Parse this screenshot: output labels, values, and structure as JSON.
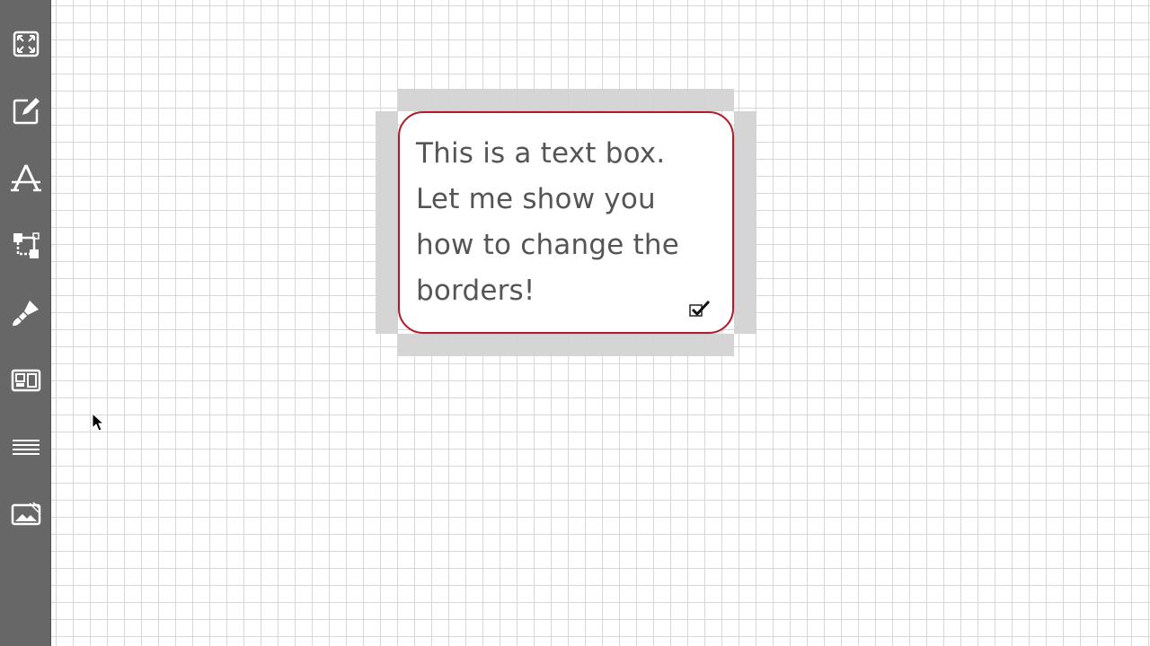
{
  "toolbar": {
    "tools": [
      {
        "name": "fit-to-screen-icon"
      },
      {
        "name": "edit-icon"
      },
      {
        "name": "shape-tool-icon"
      },
      {
        "name": "connector-icon"
      },
      {
        "name": "brush-icon"
      },
      {
        "name": "layout-icon"
      },
      {
        "name": "menu-icon"
      },
      {
        "name": "image-icon"
      }
    ]
  },
  "canvas": {
    "textbox": {
      "text": "This is a text box.\nLet me show you\nhow to change the\nborders!",
      "border_color": "#b31b2a",
      "confirm_icon": "checkmark-icon"
    }
  },
  "colors": {
    "toolbar_bg": "#676767",
    "grid_line": "#d7d7d7",
    "selection_handle": "#d3d3d3"
  }
}
